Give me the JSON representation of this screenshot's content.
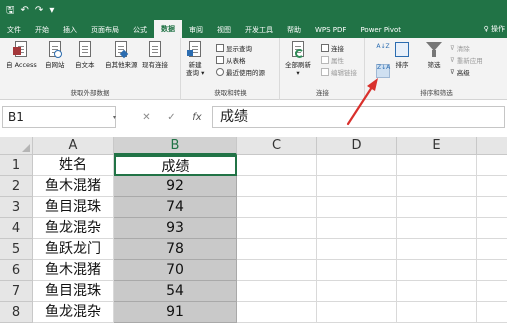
{
  "quick_access": {
    "save": "🖫",
    "undo": "↶",
    "redo": "↷",
    "more": "▾"
  },
  "tabs": [
    "文件",
    "开始",
    "插入",
    "页面布局",
    "公式",
    "数据",
    "审阅",
    "视图",
    "开发工具",
    "帮助",
    "WPS PDF",
    "Power Pivot"
  ],
  "active_tab": "数据",
  "tellme": "♀ 操作",
  "ribbon": {
    "get_external": {
      "buttons": [
        "自 Access",
        "自网站",
        "自文本",
        "自其他来源",
        "现有连接"
      ],
      "label": "获取外部数据"
    },
    "get_transform": {
      "new_query": "新建\n查询 ▾",
      "small": [
        "显示查询",
        "从表格",
        "最近使用的源"
      ],
      "label": "获取和转换"
    },
    "connections": {
      "refresh_all": "全部刷新\n▾",
      "small": [
        "连接",
        "属性",
        "编辑链接"
      ],
      "label": "连接"
    },
    "sort_filter": {
      "sort_asc": "A↓Z",
      "sort_desc": "Z↓A",
      "sort": "排序",
      "filter": "筛选",
      "small": [
        "清除",
        "重新应用",
        "高级"
      ],
      "label": "排序和筛选"
    }
  },
  "formula_bar": {
    "name_box": "B1",
    "cancel": "✕",
    "enter": "✓",
    "fx": "fx",
    "content": "成绩"
  },
  "columns": [
    "A",
    "B",
    "C",
    "D",
    "E"
  ],
  "rows": [
    {
      "n": "1",
      "a": "姓名",
      "b": "成绩"
    },
    {
      "n": "2",
      "a": "鱼木混猪",
      "b": "92"
    },
    {
      "n": "3",
      "a": "鱼目混珠",
      "b": "74"
    },
    {
      "n": "4",
      "a": "鱼龙混杂",
      "b": "93"
    },
    {
      "n": "5",
      "a": "鱼跃龙门",
      "b": "78"
    },
    {
      "n": "6",
      "a": "鱼木混猪",
      "b": "70"
    },
    {
      "n": "7",
      "a": "鱼目混珠",
      "b": "54"
    },
    {
      "n": "8",
      "a": "鱼龙混杂",
      "b": "91"
    }
  ],
  "colors": {
    "brand": "#217346",
    "annotation": "#d9302c",
    "selection": "#c9c9c9"
  }
}
